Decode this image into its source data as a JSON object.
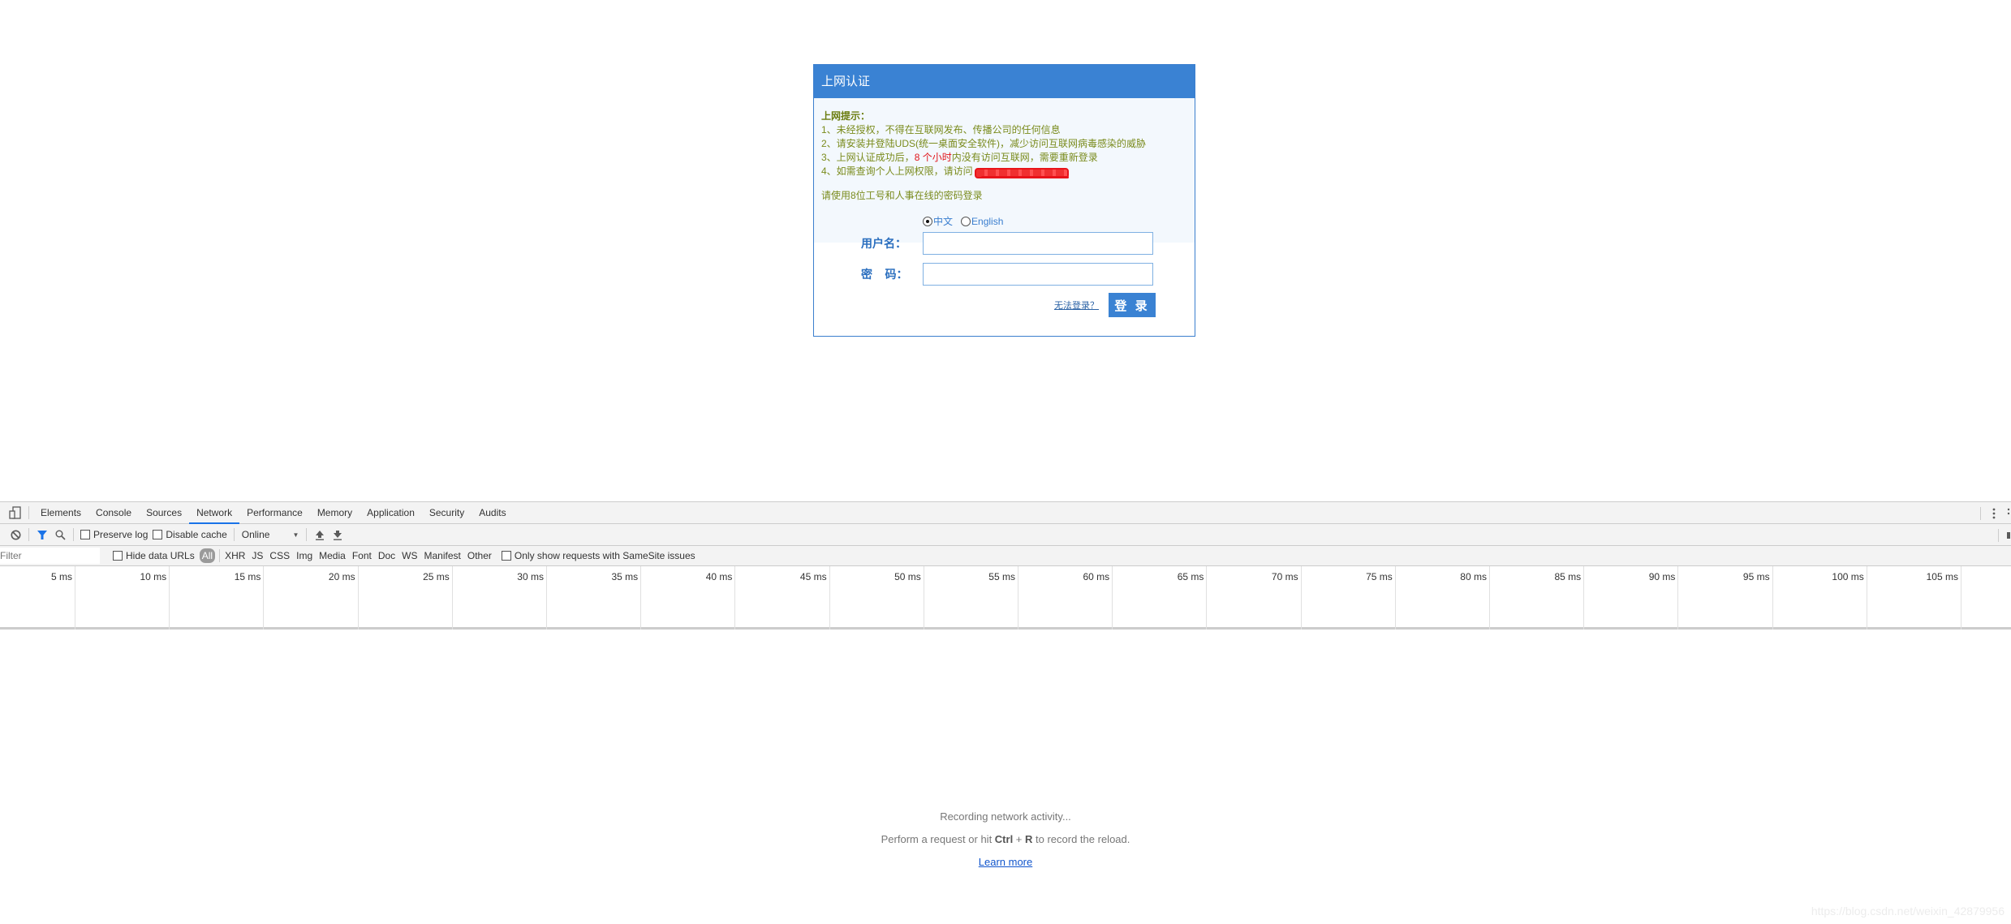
{
  "login": {
    "header_title": "上网认证",
    "notice_title": "上网提示：",
    "notice_items": [
      "1、未经授权，不得在互联网发布、传播公司的任何信息",
      "2、请安装并登陆UDS(统一桌面安全软件)，减少访问互联网病毒感染的威胁"
    ],
    "notice_item3_pre": "3、上网认证成功后，",
    "notice_item3_red": "8 个小时",
    "notice_item3_post": "内没有访问互联网，需要重新登录",
    "notice_item4_pre": "4、如需查询个人上网权限，请访问",
    "login_hint": "请使用8位工号和人事在线的密码登录",
    "languages": [
      {
        "label": "中文",
        "selected": true
      },
      {
        "label": "English",
        "selected": false
      }
    ],
    "username_label": "用户名：",
    "username_value": "",
    "password_label": "密    码：",
    "password_value": "",
    "cant_login_link": "无法登录？",
    "login_button": "登 录",
    "colors": {
      "header_bg": "#3a82d3",
      "notice_text": "#7a8b1c",
      "highlight": "#e0141a"
    }
  },
  "devtools": {
    "tabs": [
      {
        "label": "Elements",
        "active": false
      },
      {
        "label": "Console",
        "active": false
      },
      {
        "label": "Sources",
        "active": false
      },
      {
        "label": "Network",
        "active": true
      },
      {
        "label": "Performance",
        "active": false
      },
      {
        "label": "Memory",
        "active": false
      },
      {
        "label": "Application",
        "active": false
      },
      {
        "label": "Security",
        "active": false
      },
      {
        "label": "Audits",
        "active": false
      }
    ],
    "toolbar": {
      "preserve_log": "Preserve log",
      "disable_cache": "Disable cache",
      "throttle_value": "Online"
    },
    "filter": {
      "placeholder": "Filter",
      "hide_data_urls": "Hide data URLs",
      "types": [
        "All",
        "XHR",
        "JS",
        "CSS",
        "Img",
        "Media",
        "Font",
        "Doc",
        "WS",
        "Manifest",
        "Other"
      ],
      "active_type": "All",
      "samesite": "Only show requests with SameSite issues"
    },
    "timeline_ticks": [
      "5 ms",
      "10 ms",
      "15 ms",
      "20 ms",
      "25 ms",
      "30 ms",
      "35 ms",
      "40 ms",
      "45 ms",
      "50 ms",
      "55 ms",
      "60 ms",
      "65 ms",
      "70 ms",
      "75 ms",
      "80 ms",
      "85 ms",
      "90 ms",
      "95 ms",
      "100 ms",
      "105 ms"
    ],
    "empty_state": {
      "line1": "Recording network activity...",
      "line2_pre": "Perform a request or hit ",
      "line2_key1": "Ctrl",
      "line2_plus": " + ",
      "line2_key2": "R",
      "line2_post": " to record the reload.",
      "learn_more": "Learn more"
    }
  },
  "watermark": "https://blog.csdn.net/weixin_42879956"
}
